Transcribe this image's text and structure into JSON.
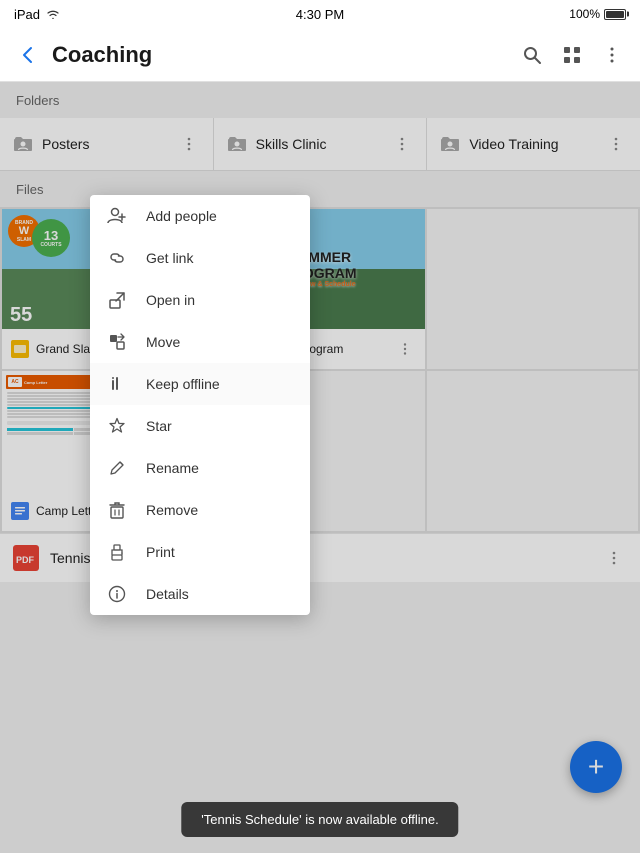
{
  "status_bar": {
    "left": "iPad",
    "time": "4:30 PM",
    "battery": "100%"
  },
  "toolbar": {
    "title": "Coaching",
    "back_label": "←",
    "search_icon": "search-icon",
    "grid_icon": "grid-icon",
    "more_icon": "more-icon"
  },
  "sections": {
    "folders_label": "Folders",
    "files_label": "Files"
  },
  "folders": [
    {
      "name": "Posters",
      "id": "posters"
    },
    {
      "name": "Skills Clinic",
      "id": "skills-clinic"
    },
    {
      "name": "Video Training",
      "id": "video-training"
    }
  ],
  "files": [
    {
      "name": "Grand Slam Summer",
      "type": "slides",
      "color": "#fbbc04"
    },
    {
      "name": "Summer Program",
      "type": "slides",
      "color": "#fbbc04"
    },
    {
      "name": "Camp Letter",
      "type": "docs",
      "color": "#4285f4"
    },
    {
      "name": "Tennis Schedule",
      "type": "pdf",
      "color": "#ea4335"
    }
  ],
  "context_menu": {
    "items": [
      {
        "id": "add-people",
        "label": "Add people",
        "icon": "person-add-icon"
      },
      {
        "id": "get-link",
        "label": "Get link",
        "icon": "link-icon"
      },
      {
        "id": "open-in",
        "label": "Open in",
        "icon": "open-in-icon"
      },
      {
        "id": "move",
        "label": "Move",
        "icon": "move-icon"
      },
      {
        "id": "keep-offline",
        "label": "Keep offline",
        "icon": "offline-icon"
      },
      {
        "id": "star",
        "label": "Star",
        "icon": "star-icon"
      },
      {
        "id": "rename",
        "label": "Rename",
        "icon": "rename-icon"
      },
      {
        "id": "remove",
        "label": "Remove",
        "icon": "remove-icon"
      },
      {
        "id": "print",
        "label": "Print",
        "icon": "print-icon"
      },
      {
        "id": "details",
        "label": "Details",
        "icon": "details-icon"
      }
    ]
  },
  "fab": {
    "label": "+"
  },
  "toast": {
    "message": "'Tennis Schedule' is now available offline."
  }
}
